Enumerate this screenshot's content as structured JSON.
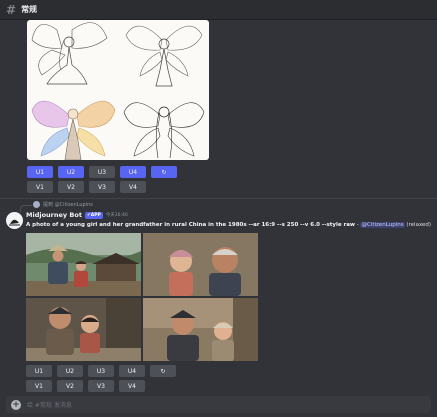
{
  "channel": {
    "icon": "hash-icon",
    "name": "常规"
  },
  "message1": {
    "buttons_upscale": [
      "U1",
      "U2",
      "U3",
      "U4"
    ],
    "buttons_variation": [
      "V1",
      "V2",
      "V3",
      "V4"
    ],
    "active_upscale": [
      "U1",
      "U2",
      "U4"
    ],
    "reroll_icon": "refresh-icon"
  },
  "message2": {
    "reply": {
      "text": "提到 @CitizenLupins"
    },
    "author": "Midjourney Bot",
    "badge": "✔APP",
    "time": "今天16:40",
    "prompt": "A photo of a young girl and her grandfather in rural China in the 1980s --ar 16:9 --s 250 --v 6.0 --style raw",
    "separator": " - ",
    "mention": "@CitizenLupins",
    "status": "(relaxed)",
    "buttons_upscale": [
      "U1",
      "U2",
      "U3",
      "U4"
    ],
    "buttons_variation": [
      "V1",
      "V2",
      "V3",
      "V4"
    ],
    "reroll_icon": "refresh-icon"
  },
  "input": {
    "plus_icon": "plus-icon",
    "placeholder": "给 #常规 发消息"
  }
}
